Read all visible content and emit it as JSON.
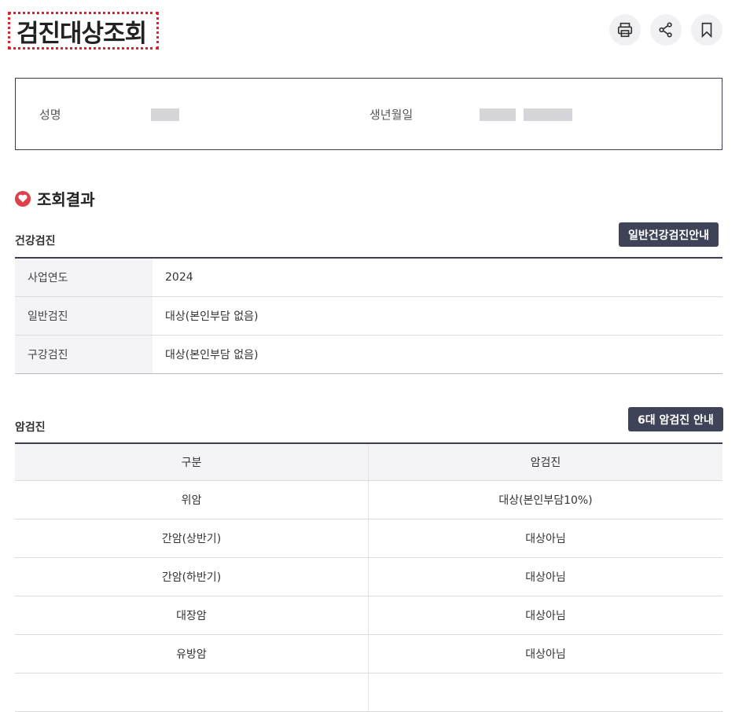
{
  "page": {
    "title": "검진대상조회"
  },
  "toolbar": {
    "print_icon": "print-icon",
    "share_icon": "share-icon",
    "bookmark_icon": "bookmark-icon"
  },
  "info": {
    "name_label": "성명",
    "birth_label": "생년월일"
  },
  "result": {
    "heading": "조회결과"
  },
  "health": {
    "title": "건강검진",
    "guide_button": "일반건강검진안내",
    "rows": [
      {
        "key": "사업연도",
        "value": "2024"
      },
      {
        "key": "일반검진",
        "value": "대상(본인부담 없음)"
      },
      {
        "key": "구강검진",
        "value": "대상(본인부담 없음)"
      }
    ]
  },
  "cancer": {
    "title": "암검진",
    "guide_button": "6대 암검진 안내",
    "headers": [
      "구분",
      "암검진"
    ],
    "rows": [
      [
        "위암",
        "대상(본인부담10%)"
      ],
      [
        "간암(상반기)",
        "대상아님"
      ],
      [
        "간암(하반기)",
        "대상아님"
      ],
      [
        "대장암",
        "대상아님"
      ],
      [
        "유방암",
        "대상아님"
      ],
      [
        "",
        ""
      ]
    ]
  },
  "colors": {
    "accent": "#e0232b",
    "dark": "#3f4357",
    "heart": "#e0404b"
  }
}
